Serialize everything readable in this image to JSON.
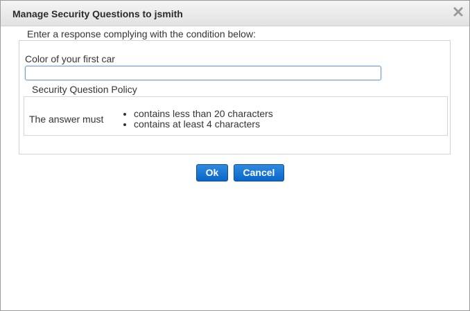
{
  "dialog": {
    "title": "Manage Security Questions to jsmith",
    "close_icon": "close-icon"
  },
  "form": {
    "legend": "Enter a response complying with the condition below:",
    "question_label": "Color of your first car",
    "answer_value": "",
    "answer_placeholder": ""
  },
  "policy": {
    "legend": "Security Question Policy",
    "lead": "The answer must",
    "rules": [
      "contains less than 20 characters",
      "contains at least 4 characters"
    ]
  },
  "buttons": {
    "ok_label": "Ok",
    "cancel_label": "Cancel"
  },
  "colors": {
    "button_blue": "#0a66c8",
    "input_focus_border": "#7a9cc6"
  }
}
